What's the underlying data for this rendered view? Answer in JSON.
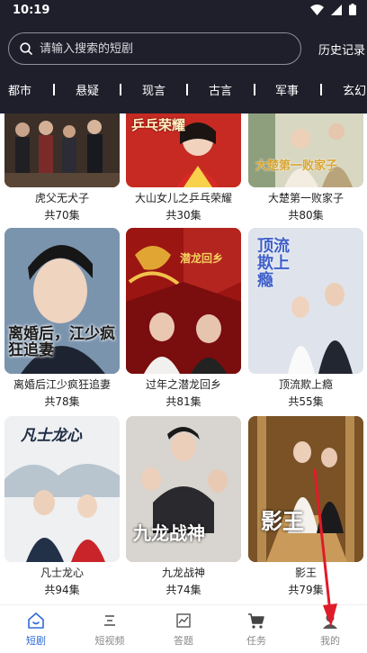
{
  "status": {
    "time": "10:19"
  },
  "search": {
    "placeholder": "请输入搜索的短剧",
    "history_label": "历史记录"
  },
  "categories": [
    "都市",
    "悬疑",
    "现言",
    "古言",
    "军事",
    "玄幻"
  ],
  "dramas": [
    {
      "title": "虎父无犬子",
      "episodes": "共70集"
    },
    {
      "title": "大山女儿之乒乓荣耀",
      "episodes": "共30集",
      "poster_text": "乒乓荣耀"
    },
    {
      "title": "大楚第一败家子",
      "episodes": "共80集",
      "poster_text": "大楚第一败家子"
    },
    {
      "title": "离婚后江少疯狂追妻",
      "episodes": "共78集",
      "poster_text": "离婚后，江少疯狂追妻"
    },
    {
      "title": "过年之潜龙回乡",
      "episodes": "共81集",
      "poster_text": "潜龙回乡"
    },
    {
      "title": "顶流欺上瘾",
      "episodes": "共55集",
      "poster_text": "顶流欺上瘾"
    },
    {
      "title": "凡士龙心",
      "episodes": "共94集",
      "poster_text": "凡士龙心"
    },
    {
      "title": "九龙战神",
      "episodes": "共74集",
      "poster_text": "九龙战神"
    },
    {
      "title": "影王",
      "episodes": "共79集",
      "poster_text": "影王"
    }
  ],
  "nav": [
    {
      "label": "短剧",
      "icon": "home-icon",
      "active": true
    },
    {
      "label": "短视频",
      "icon": "list-icon",
      "active": false
    },
    {
      "label": "答题",
      "icon": "chart-icon",
      "active": false
    },
    {
      "label": "任务",
      "icon": "cart-icon",
      "active": false
    },
    {
      "label": "我的",
      "icon": "person-icon",
      "active": false
    }
  ],
  "colors": {
    "header_bg": "#1e1f2b",
    "accent": "#2f6bd7",
    "annotation_arrow": "#e01b2a"
  }
}
